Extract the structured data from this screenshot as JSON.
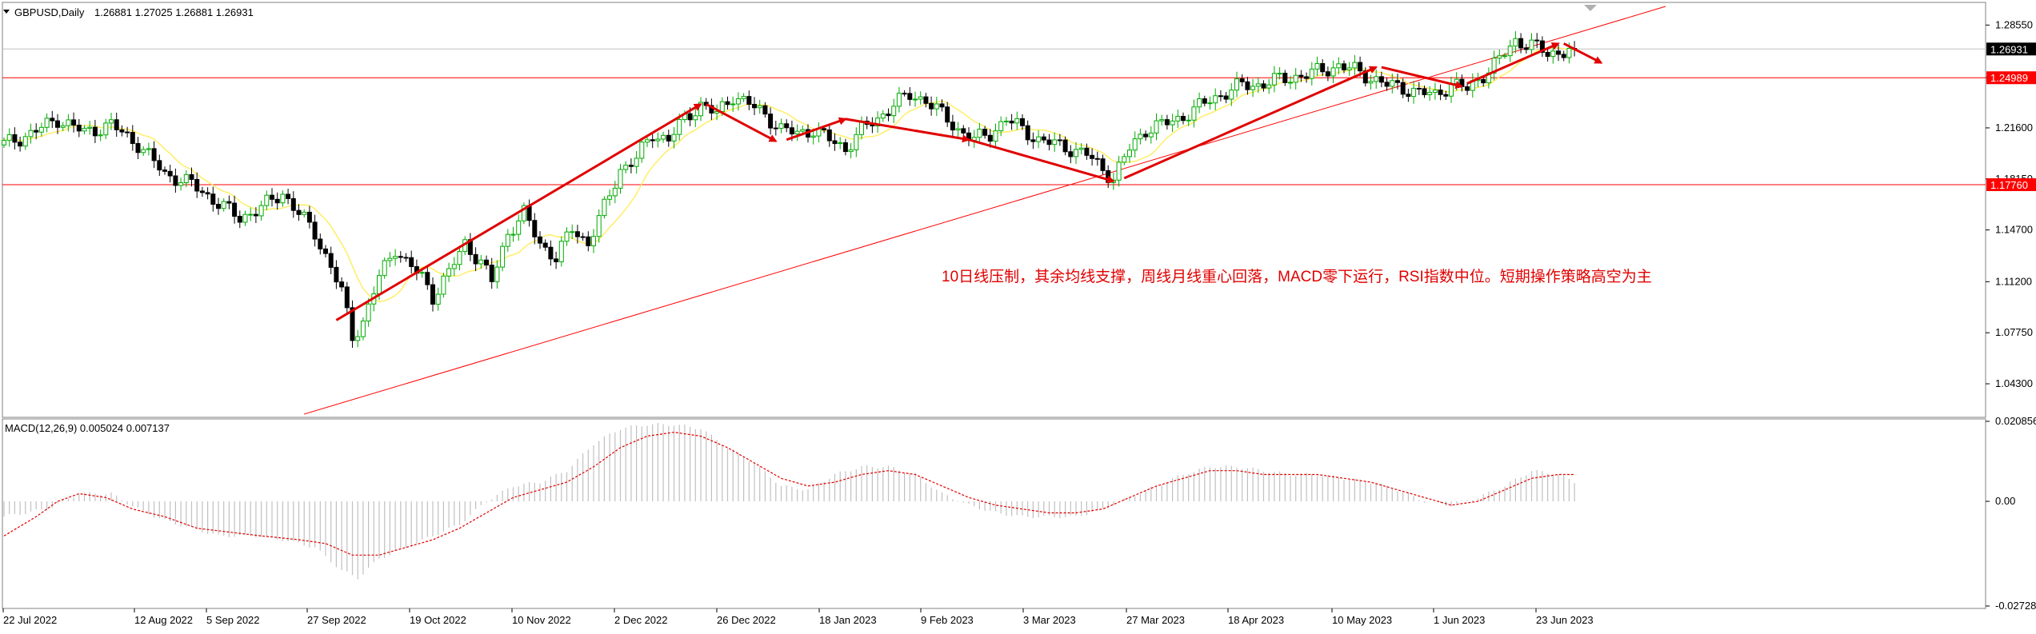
{
  "header": {
    "symbol_label": "GBPUSD,Daily",
    "ohlc": "1.26881 1.27025 1.26881 1.26931"
  },
  "macd_header": {
    "label": "MACD(12,26,9) 0.005024 0.007137"
  },
  "annotation": {
    "text": "10日线压制，其余均线支撑，周线月线重心回落，MACD零下运行，RSI指数中位。短期操作策略高空为主"
  },
  "colors": {
    "bull": "#00aa00",
    "bear": "#000000",
    "candle_bull_body": "#ffffff",
    "ma_line": "#ffee66",
    "levels": "#ff0000",
    "arrows": "#e00000",
    "macd_hist": "#c0c0c0",
    "macd_signal": "#e00000"
  },
  "chart_data": [
    {
      "type": "candlestick",
      "symbol": "GBPUSD",
      "timeframe": "Daily",
      "ylim": [
        1.0214,
        1.2992
      ],
      "y_ticks": [
        "1.28550",
        "1.25000",
        "1.21600",
        "1.18150",
        "1.14700",
        "1.11200",
        "1.07750",
        "1.04300"
      ],
      "x_ticks": [
        "22 Jul 2022",
        "12 Aug 2022",
        "5 Sep 2022",
        "27 Sep 2022",
        "19 Oct 2022",
        "10 Nov 2022",
        "2 Dec 2022",
        "26 Dec 2022",
        "18 Jan 2023",
        "9 Feb 2023",
        "3 Mar 2023",
        "27 Mar 2023",
        "18 Apr 2023",
        "10 May 2023",
        "1 Jun 2023",
        "23 Jun 2023"
      ],
      "current_price": "1.26931",
      "horizontal_levels": [
        "1.24989",
        "1.17760"
      ],
      "close_anchors": [
        [
          0,
          1.205
        ],
        [
          5,
          1.212
        ],
        [
          10,
          1.222
        ],
        [
          15,
          1.213
        ],
        [
          20,
          1.218
        ],
        [
          25,
          1.205
        ],
        [
          30,
          1.185
        ],
        [
          35,
          1.178
        ],
        [
          40,
          1.165
        ],
        [
          44,
          1.155
        ],
        [
          48,
          1.162
        ],
        [
          52,
          1.172
        ],
        [
          55,
          1.158
        ],
        [
          58,
          1.145
        ],
        [
          61,
          1.122
        ],
        [
          63,
          1.105
        ],
        [
          65,
          1.075
        ],
        [
          67,
          1.085
        ],
        [
          70,
          1.115
        ],
        [
          73,
          1.135
        ],
        [
          75,
          1.125
        ],
        [
          78,
          1.115
        ],
        [
          80,
          1.102
        ],
        [
          83,
          1.118
        ],
        [
          86,
          1.138
        ],
        [
          89,
          1.125
        ],
        [
          91,
          1.112
        ],
        [
          94,
          1.145
        ],
        [
          97,
          1.158
        ],
        [
          100,
          1.138
        ],
        [
          103,
          1.128
        ],
        [
          106,
          1.148
        ],
        [
          109,
          1.138
        ],
        [
          112,
          1.162
        ],
        [
          115,
          1.188
        ],
        [
          118,
          1.195
        ],
        [
          121,
          1.212
        ],
        [
          124,
          1.208
        ],
        [
          127,
          1.222
        ],
        [
          130,
          1.232
        ],
        [
          133,
          1.225
        ],
        [
          136,
          1.238
        ],
        [
          139,
          1.232
        ],
        [
          142,
          1.225
        ],
        [
          145,
          1.215
        ],
        [
          148,
          1.212
        ],
        [
          151,
          1.215
        ],
        [
          154,
          1.208
        ],
        [
          157,
          1.202
        ],
        [
          160,
          1.215
        ],
        [
          163,
          1.222
        ],
        [
          166,
          1.232
        ],
        [
          169,
          1.238
        ],
        [
          172,
          1.235
        ],
        [
          175,
          1.225
        ],
        [
          178,
          1.215
        ],
        [
          181,
          1.208
        ],
        [
          184,
          1.212
        ],
        [
          187,
          1.222
        ],
        [
          190,
          1.215
        ],
        [
          193,
          1.208
        ],
        [
          196,
          1.205
        ],
        [
          199,
          1.202
        ],
        [
          202,
          1.198
        ],
        [
          205,
          1.188
        ],
        [
          207,
          1.182
        ],
        [
          210,
          1.202
        ],
        [
          213,
          1.215
        ],
        [
          216,
          1.218
        ],
        [
          219,
          1.222
        ],
        [
          222,
          1.228
        ],
        [
          225,
          1.235
        ],
        [
          228,
          1.24
        ],
        [
          231,
          1.245
        ],
        [
          234,
          1.245
        ],
        [
          237,
          1.248
        ],
        [
          240,
          1.25
        ],
        [
          243,
          1.252
        ],
        [
          246,
          1.255
        ],
        [
          249,
          1.258
        ],
        [
          252,
          1.255
        ],
        [
          255,
          1.25
        ],
        [
          258,
          1.245
        ],
        [
          261,
          1.243
        ],
        [
          264,
          1.24
        ],
        [
          267,
          1.238
        ],
        [
          270,
          1.246
        ],
        [
          273,
          1.242
        ],
        [
          276,
          1.252
        ],
        [
          279,
          1.262
        ],
        [
          282,
          1.275
        ],
        [
          285,
          1.272
        ],
        [
          288,
          1.266
        ],
        [
          291,
          1.268
        ],
        [
          293,
          1.269
        ]
      ],
      "ma_line": {
        "period": 10,
        "color": "#ffee66"
      }
    },
    {
      "type": "bar",
      "name": "MACD(12,26,9)",
      "ylim": [
        -0.02728,
        0.02085
      ],
      "y_ticks": [
        "0.020856",
        "0.00",
        "-0.02728"
      ],
      "last_values": {
        "macd": 0.005024,
        "signal": 0.007137
      },
      "hist_anchors": [
        [
          0,
          -0.004
        ],
        [
          8,
          -0.002
        ],
        [
          14,
          0.002
        ],
        [
          20,
          0.002
        ],
        [
          25,
          -0.002
        ],
        [
          30,
          -0.005
        ],
        [
          35,
          -0.007
        ],
        [
          40,
          -0.009
        ],
        [
          47,
          -0.009
        ],
        [
          52,
          -0.01
        ],
        [
          58,
          -0.012
        ],
        [
          63,
          -0.018
        ],
        [
          66,
          -0.02
        ],
        [
          70,
          -0.015
        ],
        [
          75,
          -0.012
        ],
        [
          80,
          -0.009
        ],
        [
          85,
          -0.006
        ],
        [
          90,
          0.0
        ],
        [
          95,
          0.004
        ],
        [
          100,
          0.005
        ],
        [
          105,
          0.008
        ],
        [
          110,
          0.015
        ],
        [
          115,
          0.019
        ],
        [
          120,
          0.02
        ],
        [
          125,
          0.02
        ],
        [
          130,
          0.019
        ],
        [
          135,
          0.014
        ],
        [
          140,
          0.01
        ],
        [
          145,
          0.004
        ],
        [
          150,
          0.003
        ],
        [
          155,
          0.007
        ],
        [
          160,
          0.009
        ],
        [
          165,
          0.009
        ],
        [
          170,
          0.007
        ],
        [
          175,
          0.002
        ],
        [
          180,
          -0.001
        ],
        [
          185,
          -0.003
        ],
        [
          190,
          -0.004
        ],
        [
          195,
          -0.004
        ],
        [
          200,
          -0.004
        ],
        [
          205,
          -0.002
        ],
        [
          210,
          0.001
        ],
        [
          215,
          0.004
        ],
        [
          220,
          0.007
        ],
        [
          225,
          0.009
        ],
        [
          230,
          0.009
        ],
        [
          235,
          0.008
        ],
        [
          240,
          0.007
        ],
        [
          245,
          0.007
        ],
        [
          250,
          0.006
        ],
        [
          255,
          0.005
        ],
        [
          260,
          0.003
        ],
        [
          265,
          0.0
        ],
        [
          270,
          -0.001
        ],
        [
          275,
          0.001
        ],
        [
          280,
          0.004
        ],
        [
          285,
          0.008
        ],
        [
          290,
          0.007
        ],
        [
          293,
          0.005
        ]
      ],
      "signal_anchors": [
        [
          0,
          -0.009
        ],
        [
          6,
          -0.004
        ],
        [
          10,
          0.0
        ],
        [
          14,
          0.002
        ],
        [
          19,
          0.001
        ],
        [
          24,
          -0.002
        ],
        [
          30,
          -0.004
        ],
        [
          36,
          -0.007
        ],
        [
          42,
          -0.008
        ],
        [
          48,
          -0.009
        ],
        [
          55,
          -0.01
        ],
        [
          60,
          -0.011
        ],
        [
          65,
          -0.014
        ],
        [
          70,
          -0.014
        ],
        [
          75,
          -0.012
        ],
        [
          80,
          -0.01
        ],
        [
          85,
          -0.007
        ],
        [
          90,
          -0.003
        ],
        [
          95,
          0.001
        ],
        [
          100,
          0.003
        ],
        [
          105,
          0.005
        ],
        [
          110,
          0.009
        ],
        [
          115,
          0.014
        ],
        [
          120,
          0.017
        ],
        [
          125,
          0.018
        ],
        [
          130,
          0.017
        ],
        [
          135,
          0.014
        ],
        [
          140,
          0.01
        ],
        [
          145,
          0.006
        ],
        [
          150,
          0.004
        ],
        [
          155,
          0.005
        ],
        [
          160,
          0.007
        ],
        [
          165,
          0.008
        ],
        [
          170,
          0.007
        ],
        [
          175,
          0.004
        ],
        [
          180,
          0.001
        ],
        [
          185,
          -0.001
        ],
        [
          190,
          -0.002
        ],
        [
          195,
          -0.003
        ],
        [
          200,
          -0.003
        ],
        [
          205,
          -0.002
        ],
        [
          210,
          0.001
        ],
        [
          215,
          0.004
        ],
        [
          220,
          0.006
        ],
        [
          225,
          0.008
        ],
        [
          230,
          0.008
        ],
        [
          235,
          0.007
        ],
        [
          240,
          0.007
        ],
        [
          245,
          0.007
        ],
        [
          250,
          0.006
        ],
        [
          255,
          0.005
        ],
        [
          260,
          0.003
        ],
        [
          265,
          0.001
        ],
        [
          270,
          -0.001
        ],
        [
          275,
          0.0
        ],
        [
          280,
          0.003
        ],
        [
          285,
          0.006
        ],
        [
          290,
          0.007
        ],
        [
          293,
          0.007
        ]
      ]
    }
  ]
}
